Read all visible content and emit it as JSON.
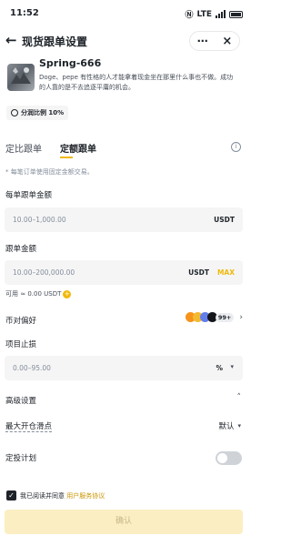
{
  "status_bar": {
    "time": "11:52",
    "network": "LTE",
    "icons": [
      "nfc-icon",
      "wifi-icon",
      "signal-icon",
      "battery-icon"
    ]
  },
  "header": {
    "title": "现货跟单设置",
    "back_icon": "arrow-left-icon",
    "more_icon": "more-dots-icon",
    "close_icon": "close-icon"
  },
  "trader": {
    "name": "Spring-666",
    "bio": "Doge、pepe 有性格的人才能拿着现金坐在那里什么事也不做。成功的人靠的是不去追逐平庸的机会。",
    "share_label": "分润比例 10%"
  },
  "tabs": [
    {
      "label": "定比跟单"
    },
    {
      "label": "定额跟单",
      "active": true
    }
  ],
  "note": "* 每笔订单使用固定金额交易。",
  "per_order": {
    "label": "每单跟单金额",
    "placeholder": "10.00–1,000.00",
    "unit": "USDT"
  },
  "follow_amount": {
    "label": "跟单金额",
    "placeholder": "10.00–200,000.00",
    "unit": "USDT",
    "max_label": "MAX"
  },
  "available": {
    "label": "可用 ≈ 0.00 USDT"
  },
  "pair_pref": {
    "label": "币对偏好",
    "count": "99+"
  },
  "stop_loss": {
    "label": "项目止损",
    "placeholder": "0.00–95.00",
    "unit": "%"
  },
  "advanced": {
    "label": "高级设置"
  },
  "slippage": {
    "label": "最大开仓滑点",
    "value": "默认"
  },
  "dca": {
    "label": "定投计划",
    "enabled": false
  },
  "agreement": {
    "prefix": "我已阅读并同意",
    "link": "用户服务协议",
    "checked": true
  },
  "confirm": {
    "label": "确认"
  },
  "colors": {
    "accent": "#f0b90b",
    "text": "#1e2329",
    "muted": "#848e9c",
    "field_bg": "#f5f5f5",
    "button_disabled": "#fbeec2"
  }
}
